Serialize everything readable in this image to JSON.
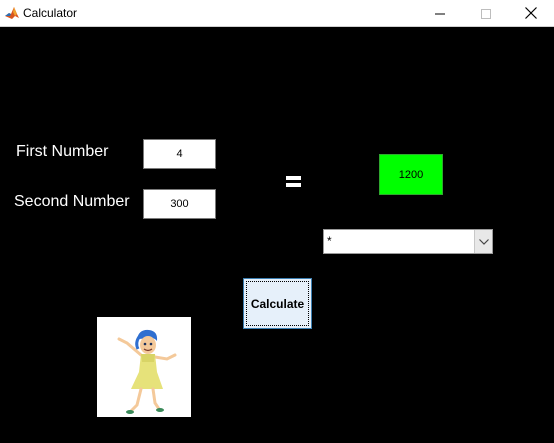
{
  "window": {
    "title": "Calculator",
    "app_icon": "matlab-icon"
  },
  "title_controls": {
    "minimize_icon": "minimize-icon",
    "maximize_icon": "maximize-icon",
    "close_icon": "close-icon"
  },
  "form": {
    "first_label": "First Number",
    "first_value": "4",
    "second_label": "Second Number",
    "second_value": "300",
    "equals_icon": "equals-sign-icon",
    "result": "1200",
    "operator": {
      "selected": "*",
      "dropdown_icon": "chevron-down-icon"
    },
    "calculate_label": "Calculate"
  },
  "picture": {
    "icon": "joy-character-image"
  },
  "colors": {
    "background": "#000000",
    "result_background": "#00ff00",
    "button_background": "#e6f0fa"
  }
}
